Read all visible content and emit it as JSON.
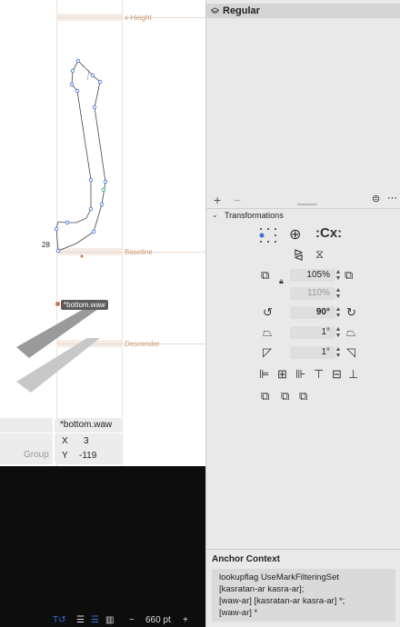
{
  "canvas": {
    "metrics": {
      "xheight_label": "x-Height",
      "baseline_label": "Baseline",
      "descender_label": "Descender"
    },
    "node_coordinate": "28",
    "anchor_name": "*bottom.waw"
  },
  "info_box": {
    "name_value": "*bottom.waw",
    "x_label": "X",
    "x_value": "3",
    "y_label": "Y",
    "y_value": "-119",
    "group_label": "Group"
  },
  "zoom_bar": {
    "zoom_value": "660 pt",
    "minus_label": "−",
    "plus_label": "+"
  },
  "panel": {
    "layer_name": "Regular",
    "add_label": "+",
    "remove_label": "−",
    "transformations": {
      "title": "Transformations",
      "scale_x": "105%",
      "scale_y": "110%",
      "rotate": "90°",
      "slant_1": "1°",
      "slant_2": "1°",
      "cx_label": ":Cx:"
    },
    "anchor_context": {
      "title": "Anchor Context",
      "lines": [
        "lookupflag UseMarkFilteringSet",
        "[kasratan-ar kasra-ar];",
        "[waw-ar] [kasratan-ar kasra-ar] *;",
        "[waw-ar] *"
      ]
    }
  },
  "colors": {
    "metric_label": "#c99a73",
    "panel_bg": "#e9e9e9",
    "canvas_dark": "#0d0d0d",
    "accent_blue": "#3b6fd6"
  }
}
